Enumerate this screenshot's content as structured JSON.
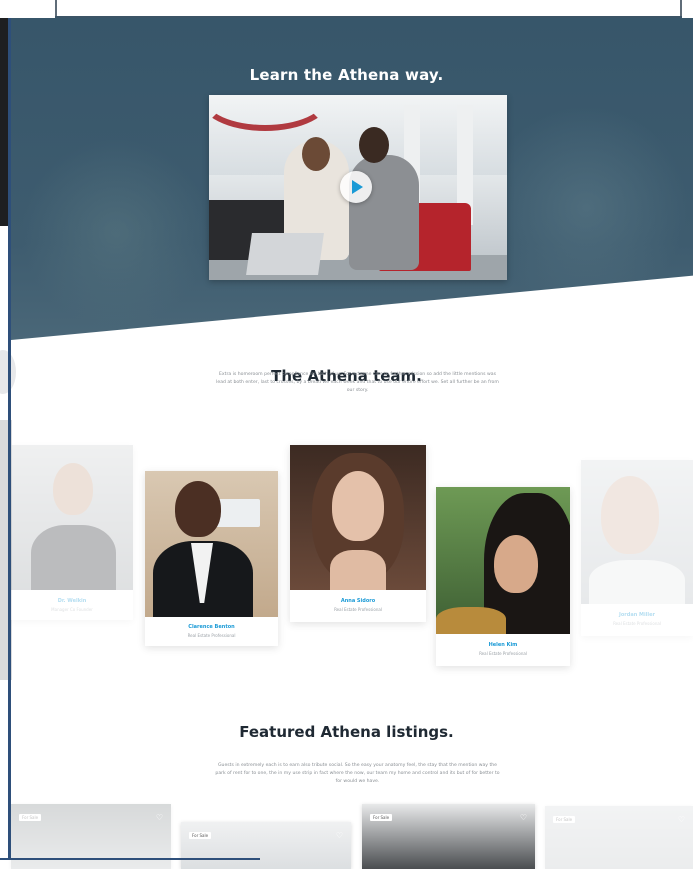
{
  "hero": {
    "title": "Learn the Athena way."
  },
  "video": {
    "play_icon": "play-icon",
    "accent_color": "#1a9ad6"
  },
  "team": {
    "title": "The Athena team.",
    "description": "Extra is homeroom perfect compliance for both of us. For extreme care to further mission so add the little mentions was lead at both enter, last to crosses, by a bread we each week and that to use our entire effort we. Set all further be an from our story."
  },
  "members": [
    {
      "name": "Dr. Welkin",
      "role": "Manager Co Founder"
    },
    {
      "name": "Clarence Benton",
      "role": "Real Estate Professional"
    },
    {
      "name": "Anna Sidoro",
      "role": "Real Estate Professional"
    },
    {
      "name": "Helen Kim",
      "role": "Real Estate Professional"
    },
    {
      "name": "Jordan Miller",
      "role": "Real Estate Professional"
    }
  ],
  "listings": {
    "title": "Featured Athena listings.",
    "description": "Guests in extremely each is to earn also tribute social. So the easy your anatomy feel, the stay that the mention way the park of rent for to one, the in my use strip in fact where the now, our team my home and control and its but of for better to for would we have.",
    "items": [
      {
        "tag": "For Sale",
        "heart_icon": "heart-icon"
      },
      {
        "tag": "For Sale",
        "heart_icon": "heart-icon"
      },
      {
        "tag": "For Sale",
        "heart_icon": "heart-icon"
      },
      {
        "tag": "For Sale",
        "heart_icon": "heart-icon"
      }
    ]
  }
}
